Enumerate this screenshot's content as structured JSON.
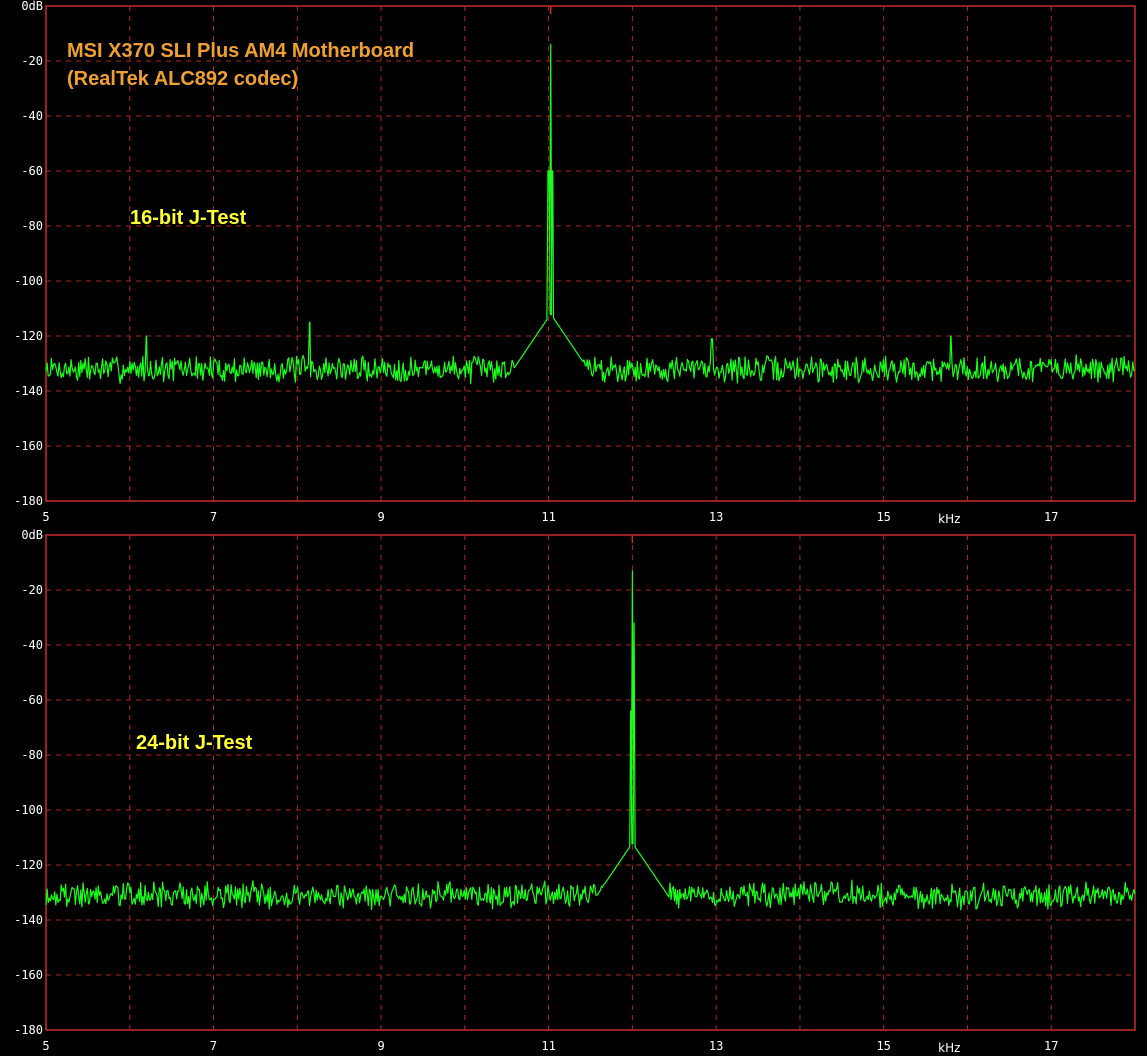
{
  "title_line1": "MSI X370 SLI Plus AM4 Motherboard",
  "title_line2": "(RealTek ALC892 codec)",
  "colors": {
    "background": "#000000",
    "frame": "#cc2a2a",
    "grid": "#b02424",
    "trace": "#19ff19",
    "tick_text": "#ffffff",
    "title": "#f0a030",
    "label": "#ffff33"
  },
  "chart_data": [
    {
      "type": "line",
      "label": "16-bit J-Test",
      "x_unit": "kHz",
      "y_tick_labels": [
        "0dB",
        "-20",
        "-40",
        "-60",
        "-80",
        "-100",
        "-120",
        "-140",
        "-160",
        "-180"
      ],
      "x_tick_labels": [
        "5",
        "7",
        "9",
        "11",
        "13",
        "15",
        "17"
      ],
      "xlim": [
        5,
        18
      ],
      "ylim": [
        -180,
        0
      ],
      "grid": true,
      "noise_floor_db": -132,
      "peaks": [
        {
          "x": 11.025,
          "y": -14
        },
        {
          "x": 11.0,
          "y": -60
        },
        {
          "x": 11.05,
          "y": -60
        },
        {
          "x": 6.2,
          "y": -120
        },
        {
          "x": 8.15,
          "y": -115
        },
        {
          "x": 12.95,
          "y": -121
        },
        {
          "x": 15.8,
          "y": -120
        }
      ]
    },
    {
      "type": "line",
      "label": "24-bit J-Test",
      "x_unit": "kHz",
      "y_tick_labels": [
        "0dB",
        "-20",
        "-40",
        "-60",
        "-80",
        "-100",
        "-120",
        "-140",
        "-160",
        "-180"
      ],
      "x_tick_labels": [
        "5",
        "7",
        "9",
        "11",
        "13",
        "15",
        "17"
      ],
      "xlim": [
        5,
        18
      ],
      "ylim": [
        -180,
        0
      ],
      "grid": true,
      "noise_floor_db": -131,
      "peaks": [
        {
          "x": 12.0,
          "y": -13
        },
        {
          "x": 11.98,
          "y": -64
        },
        {
          "x": 12.02,
          "y": -32
        }
      ]
    }
  ]
}
